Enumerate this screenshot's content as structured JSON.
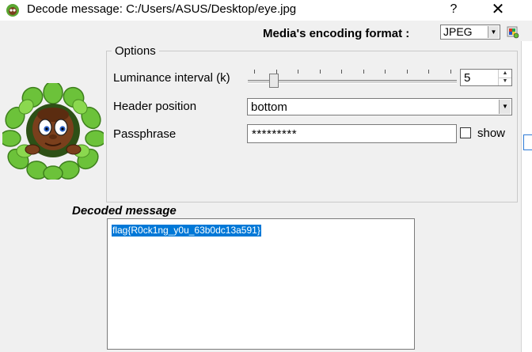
{
  "window": {
    "title": "Decode message: C:/Users/ASUS/Desktop/eye.jpg",
    "help_symbol": "?",
    "close_symbol": "✕",
    "icon": "mascot-app-icon"
  },
  "encoding": {
    "label": "Media's encoding format :",
    "selected": "JPEG",
    "info_icon": "palette-info-icon"
  },
  "options": {
    "legend": "Options",
    "luminance": {
      "label": "Luminance interval (k)",
      "value": "5",
      "slider_fraction": 0.03
    },
    "header_position": {
      "label": "Header position",
      "selected": "bottom"
    },
    "passphrase": {
      "label": "Passphrase",
      "value": "*********",
      "show_label": "show",
      "show_checked": false
    }
  },
  "decoded": {
    "label": "Decoded message",
    "text": "flag{R0ck1ng_y0u_63b0dc13a591}"
  },
  "colors": {
    "selection": "#0078d7",
    "window_bg": "#f0f0f0"
  }
}
